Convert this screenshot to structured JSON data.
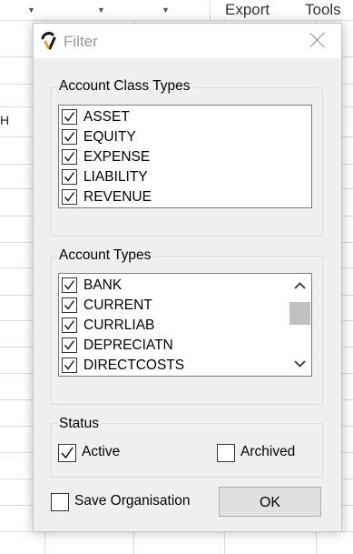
{
  "toolbar": {
    "export_label": "Export",
    "tools_label": "Tools"
  },
  "sheet": {
    "cell_text": "H"
  },
  "dialog": {
    "title": "Filter",
    "account_class_types": {
      "label": "Account Class Types",
      "items": [
        {
          "label": "ASSET",
          "checked": true
        },
        {
          "label": "EQUITY",
          "checked": true
        },
        {
          "label": "EXPENSE",
          "checked": true
        },
        {
          "label": "LIABILITY",
          "checked": true
        },
        {
          "label": "REVENUE",
          "checked": true
        }
      ]
    },
    "account_types": {
      "label": "Account Types",
      "items": [
        {
          "label": "BANK",
          "checked": true
        },
        {
          "label": "CURRENT",
          "checked": true
        },
        {
          "label": "CURRLIAB",
          "checked": true
        },
        {
          "label": "DEPRECIATN",
          "checked": true
        },
        {
          "label": "DIRECTCOSTS",
          "checked": true
        }
      ]
    },
    "status": {
      "label": "Status",
      "active": {
        "label": "Active",
        "checked": true
      },
      "archived": {
        "label": "Archived",
        "checked": false
      }
    },
    "save_organisation": {
      "label": "Save Organisation",
      "checked": false
    },
    "ok_label": "OK"
  },
  "colors": {
    "dialog_bg": "#f0f0f0",
    "border": "#7a7a7a",
    "scroll_thumb": "#c1c1c1",
    "button_bg": "#e1e1e1"
  }
}
